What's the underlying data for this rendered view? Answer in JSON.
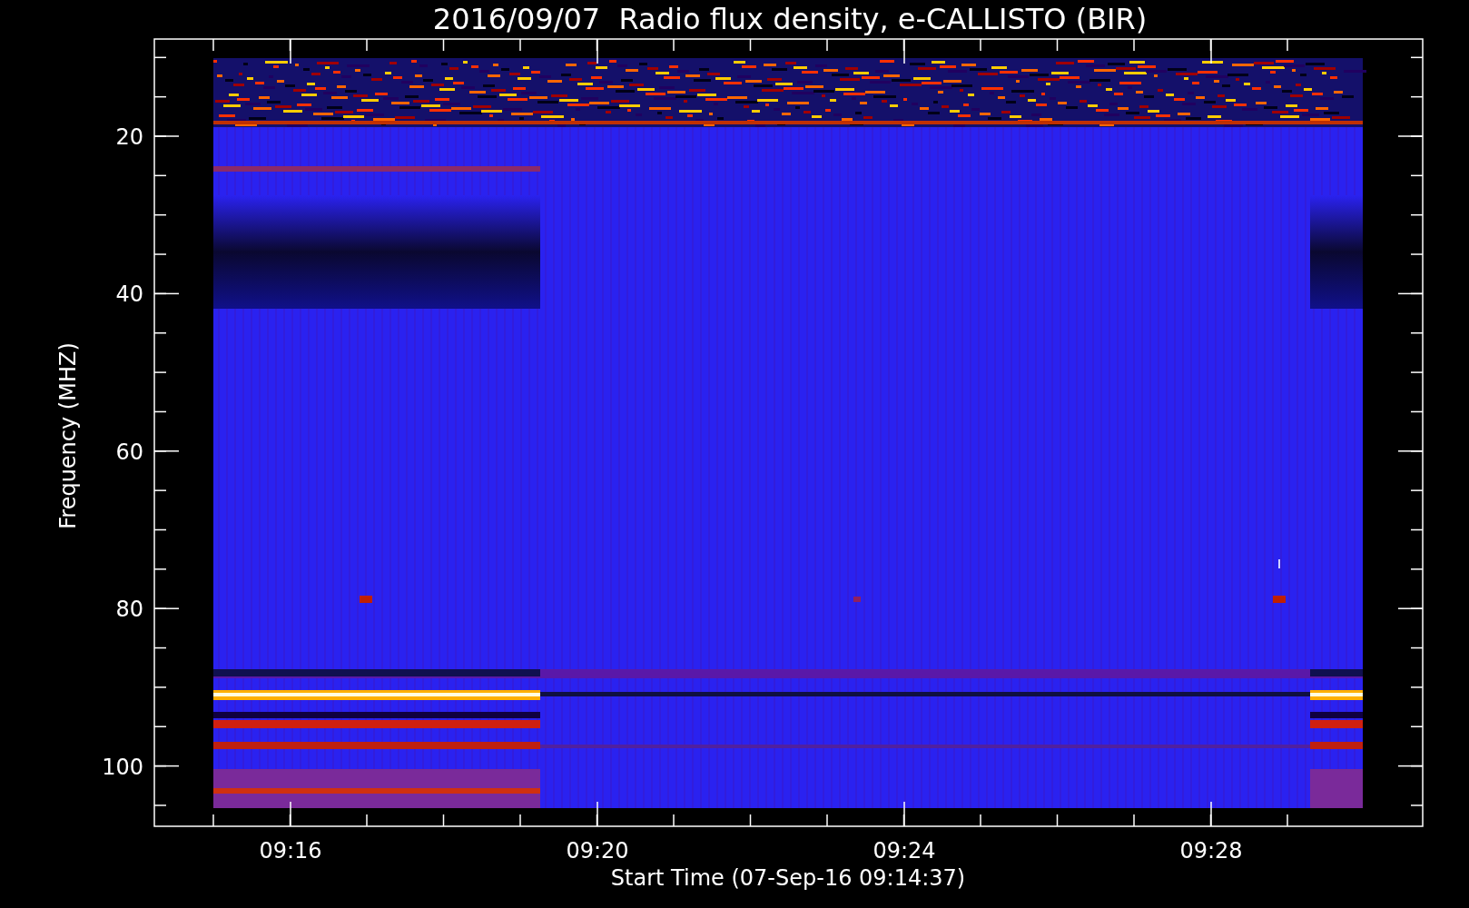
{
  "title": "2016/09/07  Radio flux density, e-CALLISTO (BIR)",
  "y_axis": {
    "label": "Frequency (MHZ)",
    "ticks": [
      "20",
      "40",
      "60",
      "80",
      "100"
    ]
  },
  "x_axis": {
    "label": "Start Time (07-Sep-16 09:14:37)",
    "ticks": [
      "09:16",
      "09:20",
      "09:24",
      "09:28"
    ]
  }
}
